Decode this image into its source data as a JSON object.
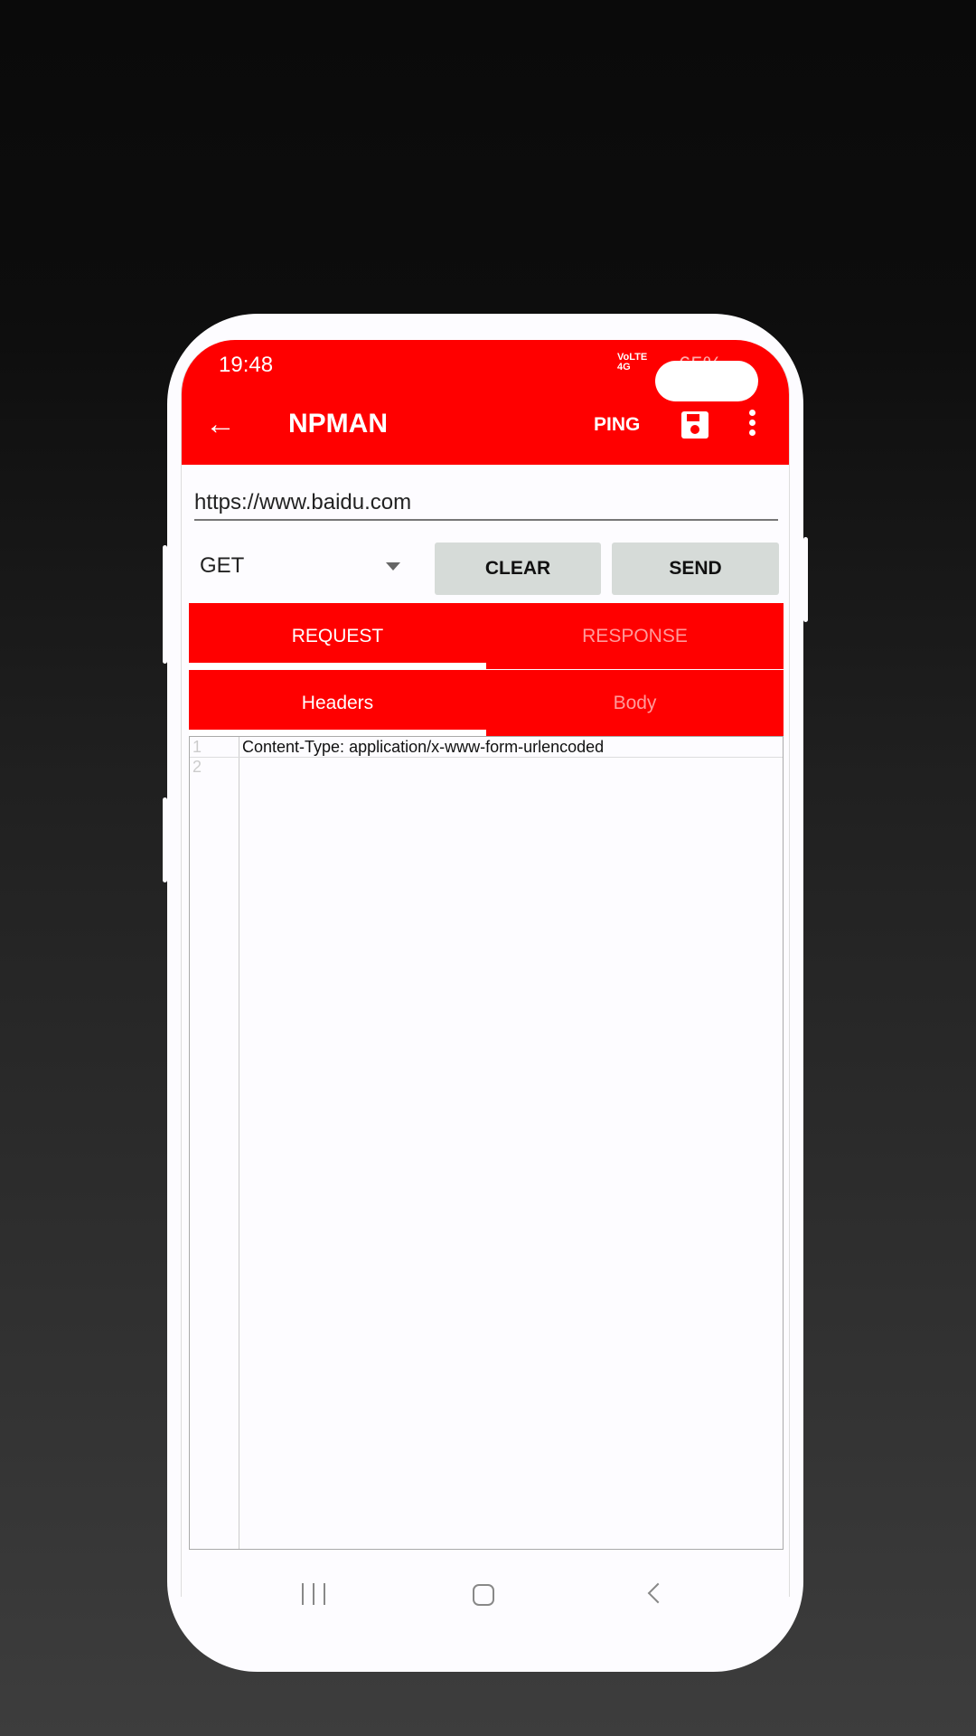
{
  "status_bar": {
    "time": "19:48",
    "signal": "VoLTE 4G",
    "battery": "65%"
  },
  "app_bar": {
    "title": "NPMAN",
    "ping_label": "PING",
    "back_icon": "arrow-left-icon",
    "save_icon": "floppy-disk-icon",
    "more_icon": "more-vert-icon"
  },
  "request": {
    "url": "https://www.baidu.com",
    "method": "GET",
    "clear_label": "CLEAR",
    "send_label": "SEND"
  },
  "tabs": [
    {
      "label": "REQUEST",
      "selected": true
    },
    {
      "label": "RESPONSE",
      "selected": false
    }
  ],
  "subtabs": [
    {
      "label": "Headers",
      "selected": true
    },
    {
      "label": "Body",
      "selected": false
    }
  ],
  "editor": {
    "lines": [
      {
        "number": "1",
        "text": "Content-Type: application/x-www-form-urlencoded"
      },
      {
        "number": "2",
        "text": ""
      }
    ]
  },
  "colors": {
    "primary": "#ff0000",
    "button": "#d6dbd8"
  }
}
